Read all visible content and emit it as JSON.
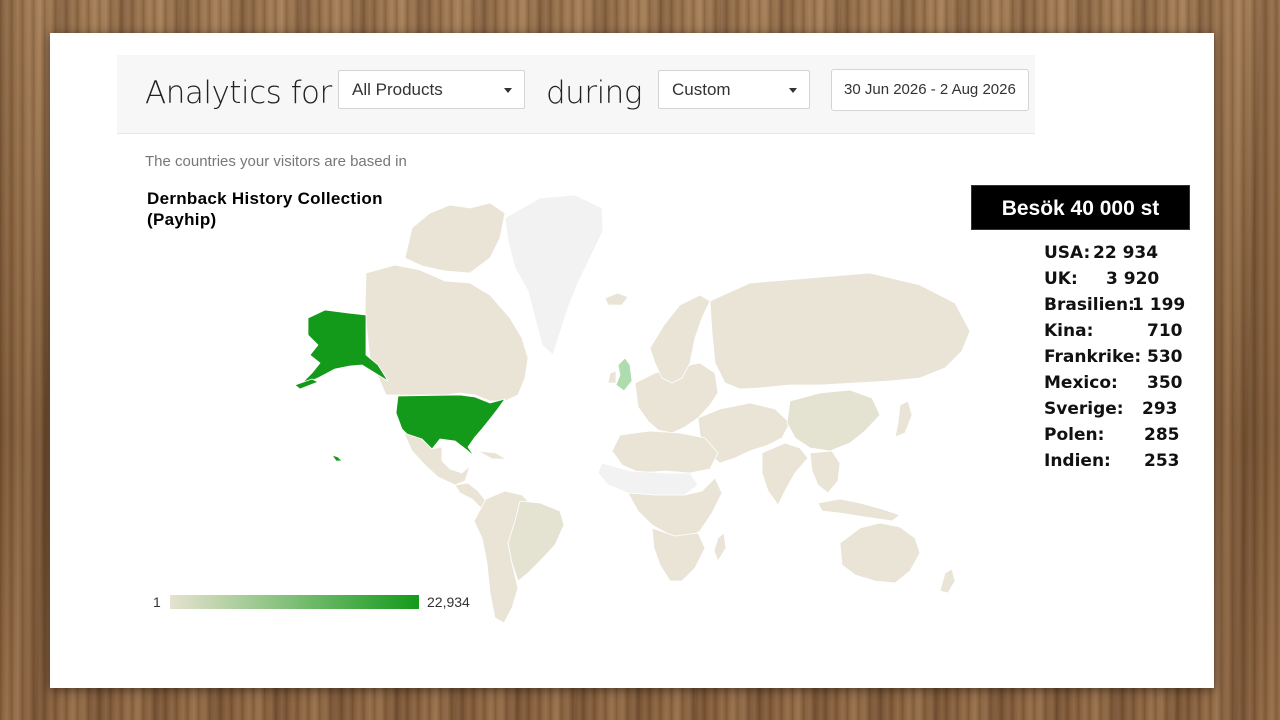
{
  "header": {
    "analytics_for": "Analytics for",
    "product_select": "All Products",
    "during": "during",
    "period_select": "Custom",
    "date_range": "30 Jun 2026 - 2 Aug 2026"
  },
  "map": {
    "subtitle": "The countries your visitors are based in",
    "collection_line1": "Dernback History Collection",
    "collection_line2": "(Payhip)",
    "legend_min": "1",
    "legend_max": "22,934",
    "colors": {
      "highest": "#139a1b",
      "low": "#eae4d7",
      "mid": "#e4e3d2",
      "no_data": "#f2f2f2",
      "water": "#ffffff"
    }
  },
  "summary": {
    "total_visits": "Besök 40 000 st",
    "countries": [
      {
        "country": "USA:",
        "value": "22 934"
      },
      {
        "country": "UK:",
        "value": "3 920"
      },
      {
        "country": "Brasilien:",
        "value": "1 199"
      },
      {
        "country": "Kina:",
        "value": "710"
      },
      {
        "country": "Frankrike:",
        "value": "530"
      },
      {
        "country": "Mexico:",
        "value": "350"
      },
      {
        "country": "Sverige:",
        "value": "293"
      },
      {
        "country": "Polen:",
        "value": "285"
      },
      {
        "country": "Indien:",
        "value": "253"
      }
    ]
  }
}
